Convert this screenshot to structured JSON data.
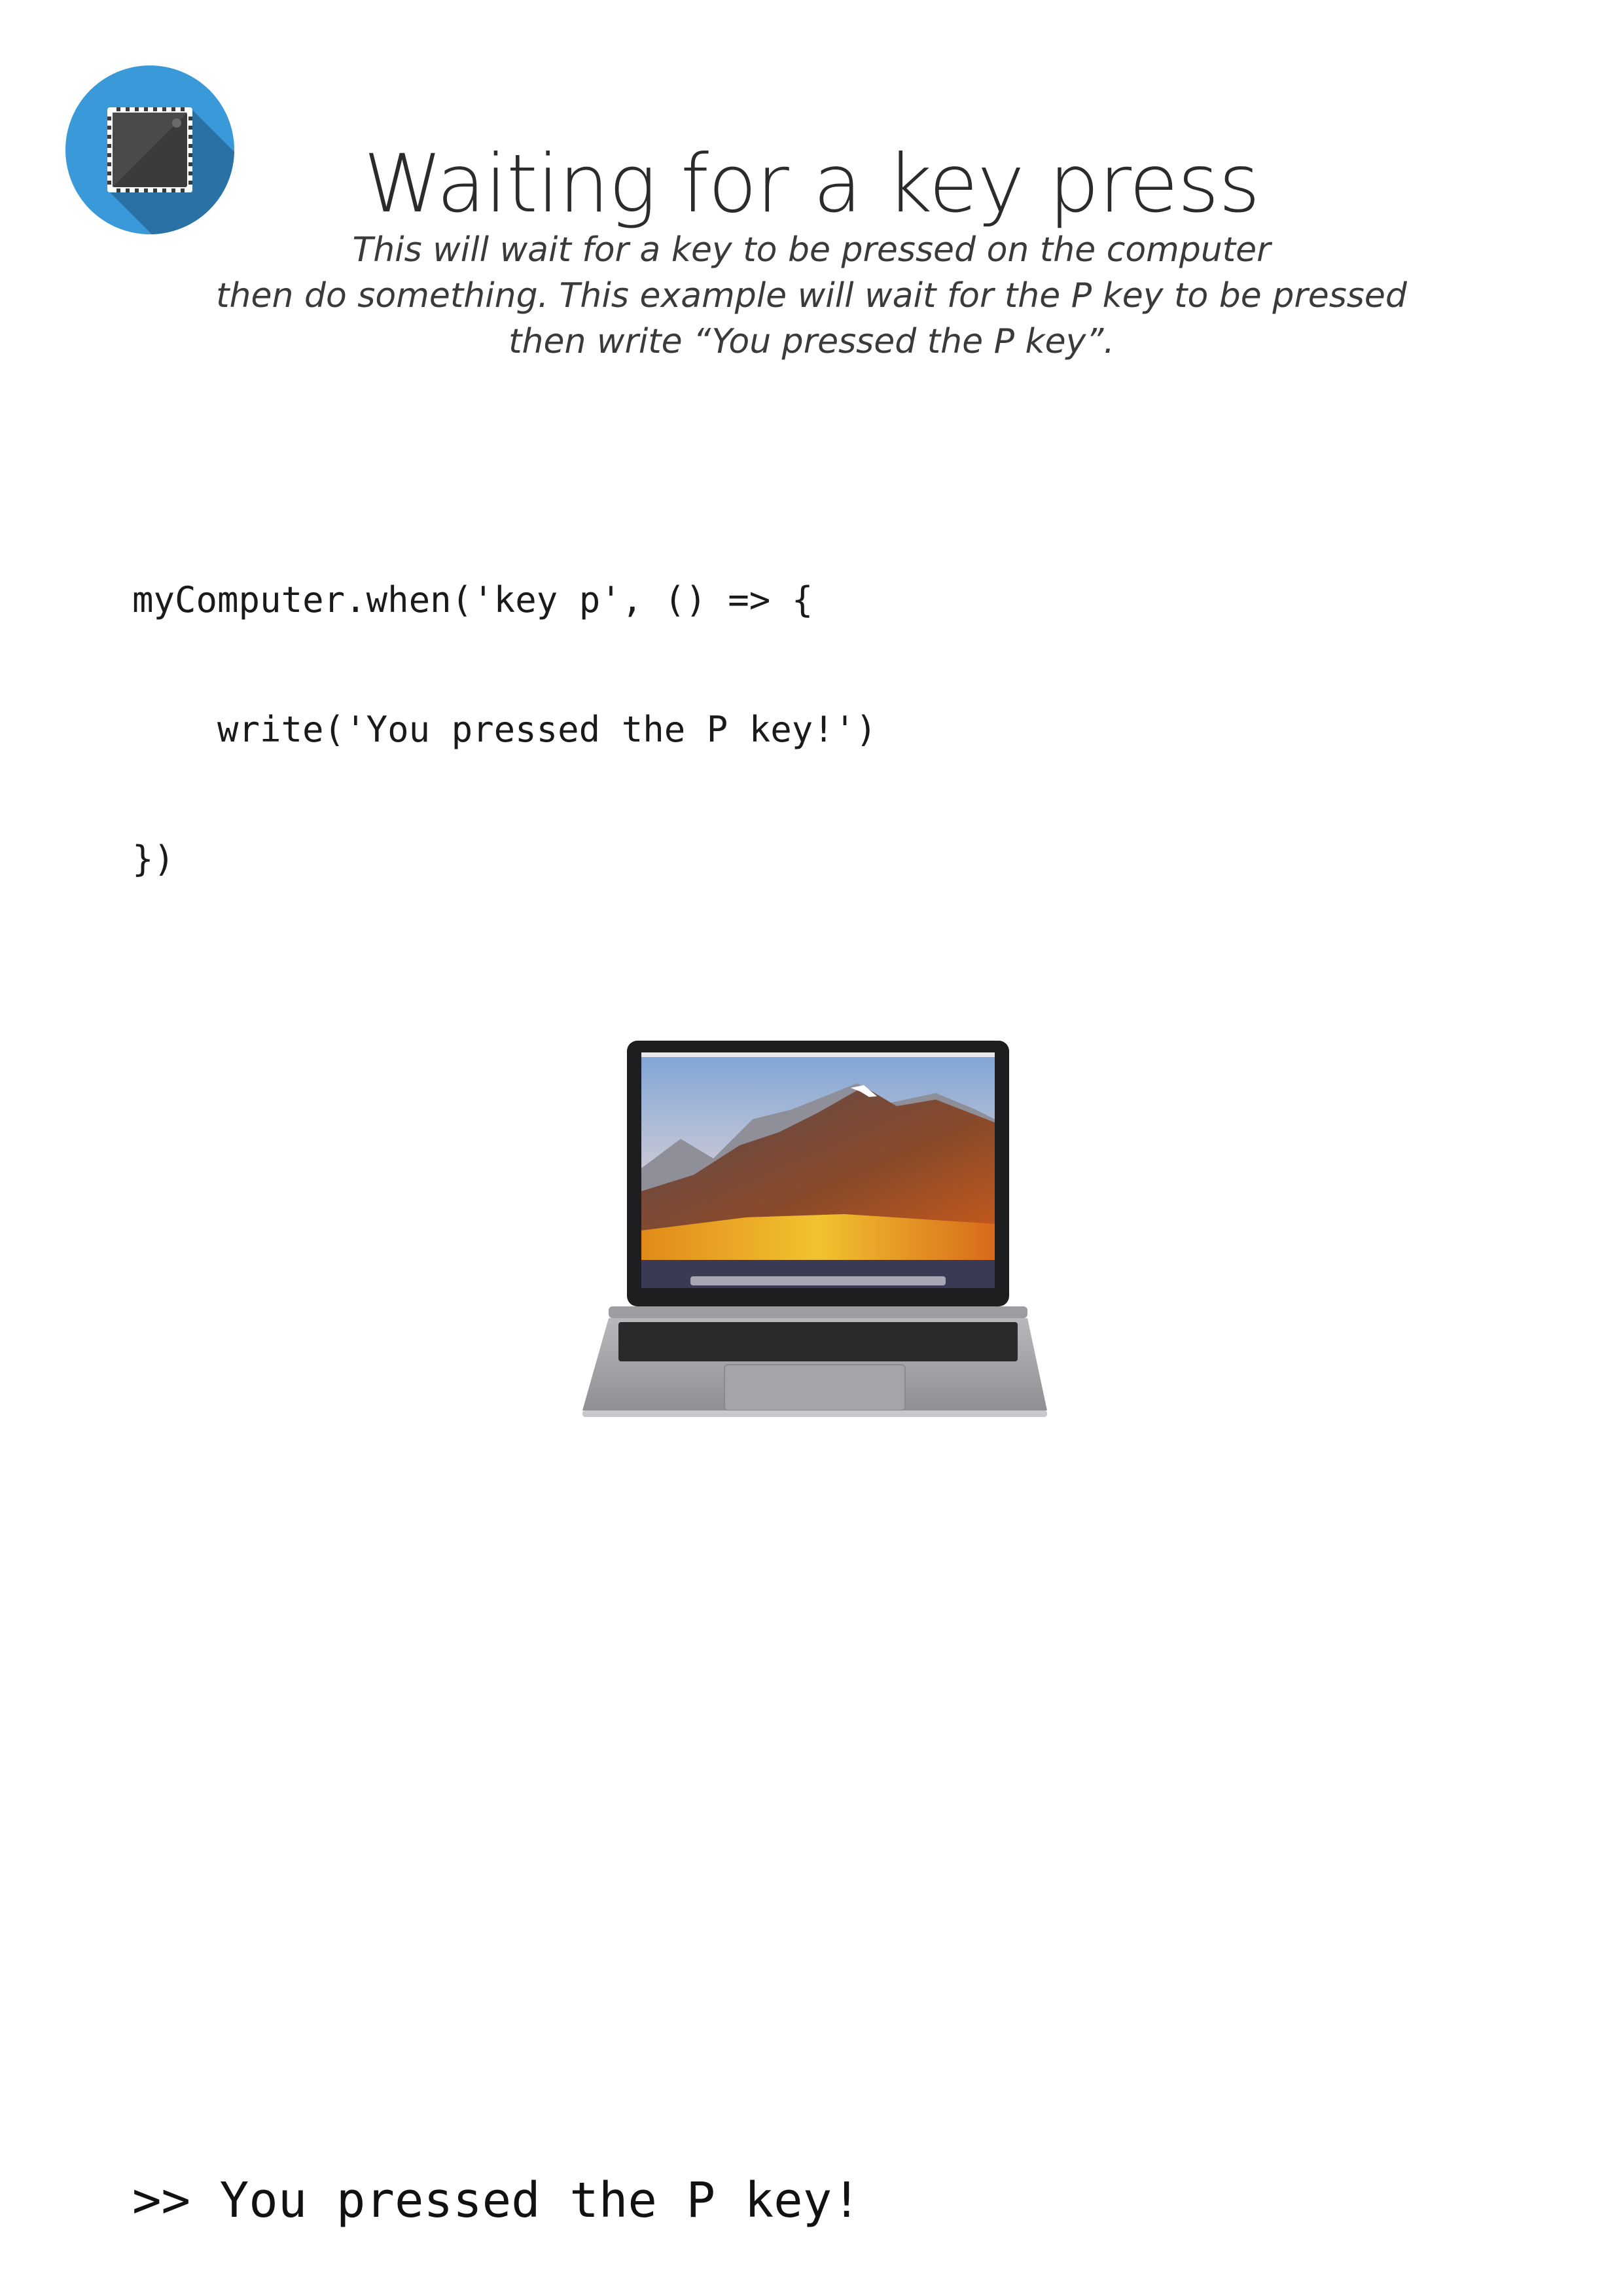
{
  "header": {
    "logo_icon": "microchip-icon",
    "title": "Waiting for a key press"
  },
  "description": {
    "lines": [
      "This will wait for a key to be pressed on the computer",
      "then do something. This example will wait for the P key to be pressed",
      "then write “You pressed the P key”."
    ]
  },
  "code": {
    "lines": [
      "myComputer.when('key p', () => {",
      "write('You pressed the P key!')",
      "})"
    ]
  },
  "illustration": {
    "icon": "laptop-icon"
  },
  "output": {
    "text": ">> You pressed the P key!"
  },
  "colors": {
    "logo_circle": "#3a9ad9",
    "logo_shadow": "#2a72a6",
    "chip_body": "#3b3b3b"
  }
}
